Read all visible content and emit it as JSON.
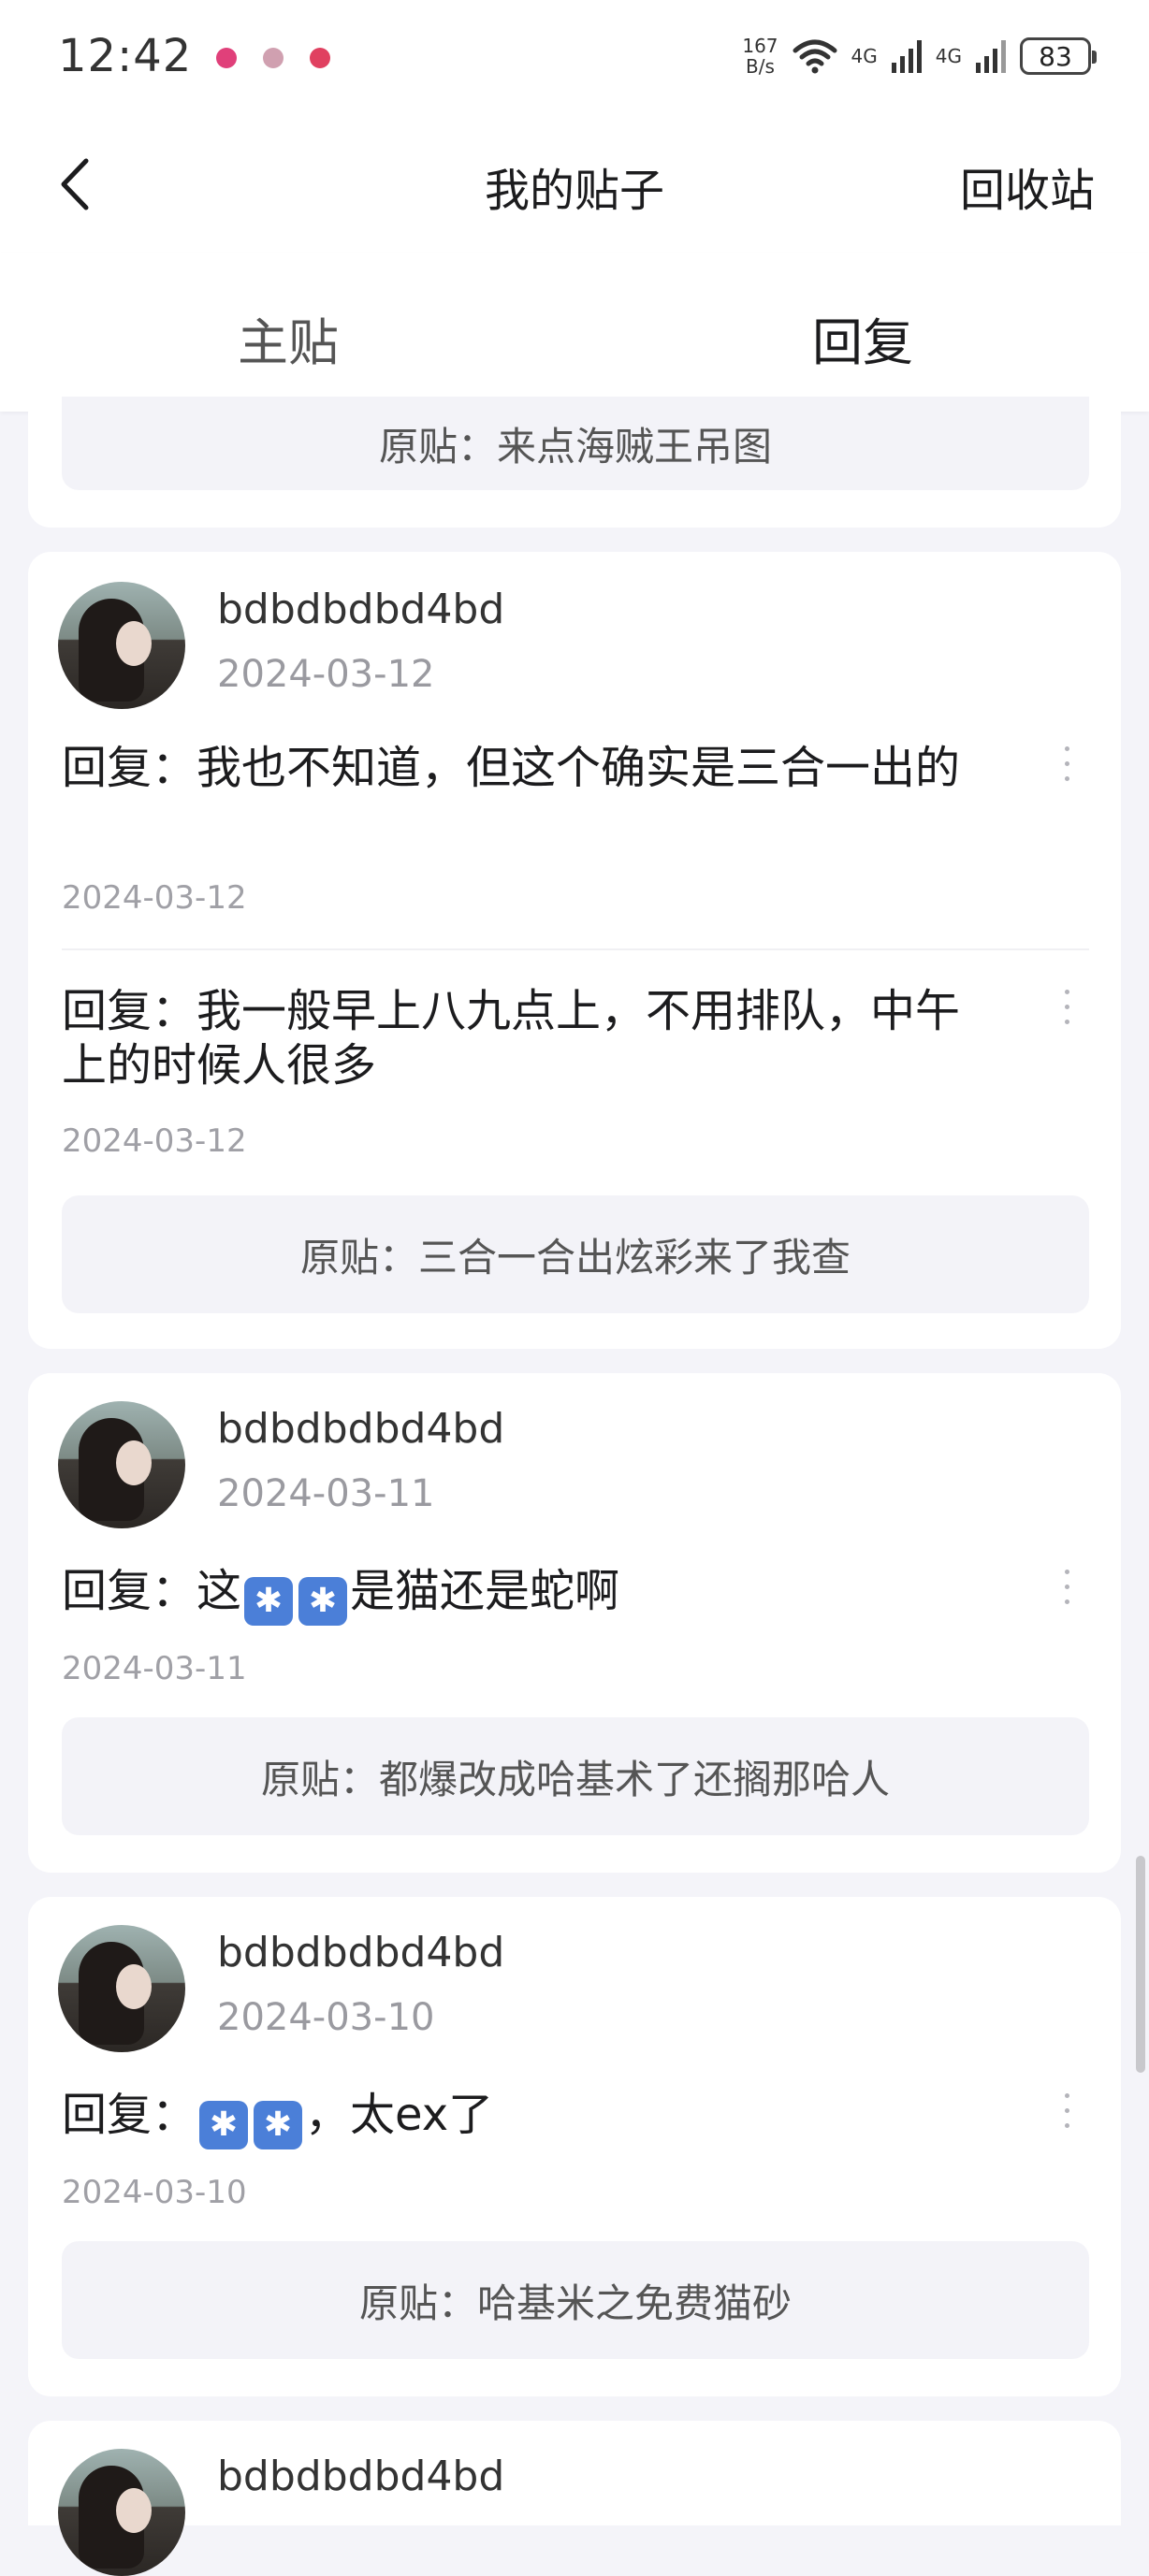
{
  "status_bar": {
    "time": "12:42",
    "net_speed_value": "167",
    "net_speed_unit": "B/s",
    "signal_1": "4G",
    "signal_2": "4G",
    "battery": "83",
    "notification_colors": [
      "#e0407a",
      "#d0a0b0",
      "#e04060"
    ]
  },
  "nav": {
    "title": "我的贴子",
    "recycle_bin": "回收站"
  },
  "tabs": {
    "main": "主贴",
    "reply": "回复",
    "active": "reply"
  },
  "cards": [
    {
      "original_post": "原贴：来点海贼王吊图"
    },
    {
      "username": "bdbdbdbd4bd",
      "date": "2024-03-12",
      "replies": [
        {
          "text": "回复：我也不知道，但这个确实是三合一出的",
          "date": "2024-03-12"
        },
        {
          "text": "回复：我一般早上八九点上，不用排队，中午上的时候人很多",
          "date": "2024-03-12"
        }
      ],
      "original_post": "原贴：三合一合出炫彩来了我查"
    },
    {
      "username": "bdbdbdbd4bd",
      "date": "2024-03-11",
      "reply_prefix": "回复：这",
      "reply_suffix": "是猫还是蛇啊",
      "reply_date": "2024-03-11",
      "original_post": "原贴：都爆改成哈基术了还搁那哈人"
    },
    {
      "username": "bdbdbdbd4bd",
      "date": "2024-03-10",
      "reply_prefix": "回复：",
      "reply_suffix": "，太ex了",
      "reply_date": "2024-03-10",
      "original_post": "原贴：哈基米之免费猫砂"
    },
    {
      "username": "bdbdbdbd4bd"
    }
  ],
  "emoji_icon": "emoji-asterisk-icon",
  "emoji_glyph": "✱"
}
